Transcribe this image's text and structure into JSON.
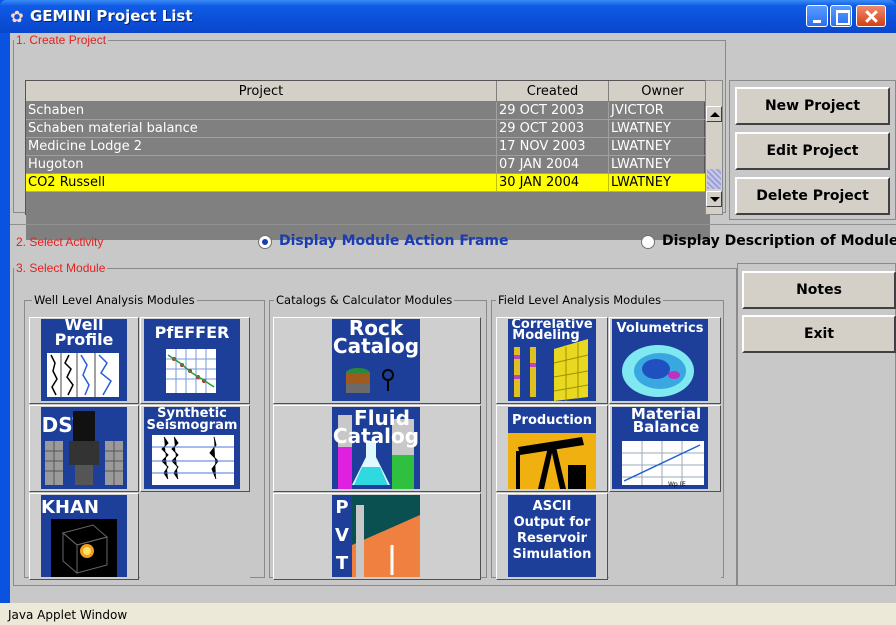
{
  "window": {
    "title": "GEMINI Project List"
  },
  "sections": {
    "create_project": "1. Create Project",
    "select_activity": "2. Select Activity",
    "select_module": "3. Select Module"
  },
  "table": {
    "columns": [
      "Project",
      "Created",
      "Owner"
    ],
    "rows": [
      {
        "project": "Schaben",
        "created": "29 OCT 2003",
        "owner": "JVICTOR",
        "selected": false
      },
      {
        "project": "Schaben material balance",
        "created": "29 OCT 2003",
        "owner": "LWATNEY",
        "selected": false
      },
      {
        "project": "Medicine Lodge 2",
        "created": "17 NOV 2003",
        "owner": "LWATNEY",
        "selected": false
      },
      {
        "project": "Hugoton",
        "created": "07 JAN 2004",
        "owner": "LWATNEY",
        "selected": false
      },
      {
        "project": "CO2 Russell",
        "created": "30 JAN 2004",
        "owner": "LWATNEY",
        "selected": true
      }
    ]
  },
  "project_buttons": {
    "new": "New Project",
    "edit": "Edit Project",
    "delete": "Delete Project"
  },
  "activity": {
    "option1": "Display Module Action Frame",
    "option2": "Display Description of Module",
    "selected": "option1"
  },
  "groups": {
    "well": "Well Level Analysis Modules",
    "catalogs": "Catalogs & Calculator Modules",
    "field": "Field Level Analysis Modules"
  },
  "modules": {
    "well_profile": {
      "line1": "Well",
      "line2": "Profile"
    },
    "pfeffer": {
      "line1": "PfEFFER"
    },
    "dst": {
      "line1": "DST"
    },
    "synthetic": {
      "line1": "Synthetic",
      "line2": "Seismogram"
    },
    "khan": {
      "line1": "KHAN"
    },
    "rock_catalog": {
      "line1": "Rock",
      "line2": "Catalog"
    },
    "fluid_catalog": {
      "line1": "Fluid",
      "line2": "Catalog"
    },
    "pvt": {
      "p": "P",
      "v": "V",
      "t": "T"
    },
    "correlative": {
      "line1": "Correlative",
      "line2": "Modeling"
    },
    "volumetrics": {
      "line1": "Volumetrics"
    },
    "production": {
      "line1": "Production"
    },
    "material_balance": {
      "line1": "Material",
      "line2": "Balance",
      "axis": "Wp (E"
    },
    "ascii": {
      "line1": "ASCII",
      "line2": "Output for",
      "line3": "Reservoir",
      "line4": "Simulation"
    }
  },
  "side_buttons": {
    "notes": "Notes",
    "exit": "Exit"
  },
  "status": "Java Applet Window",
  "colors": {
    "title_blue": "#0a53e0",
    "selected_row": "#ffff00",
    "section_red": "#e62020",
    "radio_text_blue": "#1a3cb0",
    "icon_blue": "#1d3f9a"
  }
}
